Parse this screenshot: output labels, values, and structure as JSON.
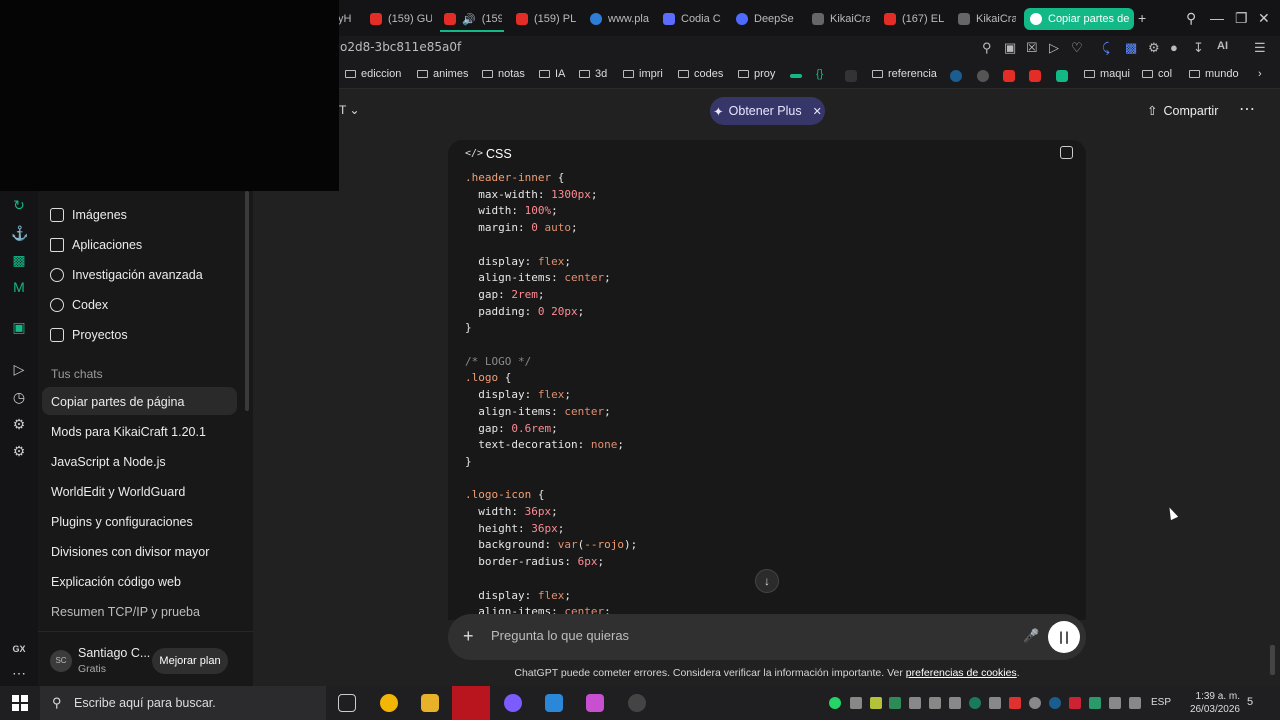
{
  "tabs": [
    {
      "label": "yH",
      "color": "#666"
    },
    {
      "label": "(159) GU",
      "color": "#e52d27"
    },
    {
      "label": "(159",
      "color": "#e52d27"
    },
    {
      "label": "(159) PL",
      "color": "#e52d27"
    },
    {
      "label": "www.pla",
      "color": "#2e7dd7"
    },
    {
      "label": "Codia C",
      "color": "#5b6cff"
    },
    {
      "label": "DeepSe",
      "color": "#4d6bfe"
    },
    {
      "label": "KikaiCra",
      "color": "#999"
    },
    {
      "label": "(167) EL",
      "color": "#e52d27"
    },
    {
      "label": "KikaiCra",
      "color": "#999"
    },
    {
      "label": "Copiar partes de",
      "color": "#fff",
      "active": true
    }
  ],
  "address": {
    "url": "o2d8-3bc811e85a0f"
  },
  "bookmarks": [
    "ediccion",
    "animes",
    "notas",
    "IA",
    "3d",
    "impri",
    "codes",
    "proy",
    "{}",
    "referencia",
    "maqui",
    "col",
    "mundo"
  ],
  "nav": {
    "imagenes": "Imágenes",
    "aplicaciones": "Aplicaciones",
    "investigacion": "Investigación avanzada",
    "codex": "Codex",
    "proyectos": "Proyectos"
  },
  "section_label": "Tus chats",
  "chats": [
    "Copiar partes de página",
    "Mods para KikaiCraft 1.20.1",
    "JavaScript a Node.js",
    "WorldEdit y WorldGuard",
    "Plugins y configuraciones",
    "Divisiones con divisor mayor",
    "Explicación código web",
    "Resumen TCP/IP y prueba"
  ],
  "user": {
    "initials": "SC",
    "name": "Santiago C...",
    "plan": "Gratis",
    "upgrade": "Mejorar plan"
  },
  "header": {
    "model_suffix": "T",
    "plus_label": "Obtener Plus",
    "share_label": "Compartir"
  },
  "code": {
    "lang_icon": "</>",
    "lang": "CSS"
  },
  "composer": {
    "placeholder": "Pregunta lo que quieras"
  },
  "disclaimer": {
    "text": "ChatGPT puede cometer errores. Considera verificar la información importante. Ver ",
    "link": "preferencias de cookies",
    "end": "."
  },
  "taskbar": {
    "search": "Escribe aquí para buscar.",
    "lang": "ESP",
    "time": "1:39 a. m.",
    "date": "26/03/2026",
    "notif": "5"
  },
  "colors": {
    "accent": "#12b886",
    "plus_pill": "#373669",
    "bg": "#212121",
    "sidebar": "#181818"
  }
}
